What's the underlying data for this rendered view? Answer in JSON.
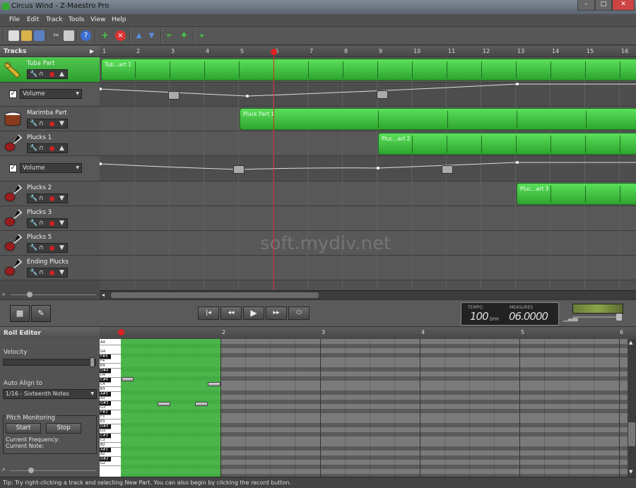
{
  "window": {
    "title": "Circus Wind - Z-Maestro Pro",
    "min": "–",
    "max": "□",
    "close": "✕"
  },
  "menu": [
    "File",
    "Edit",
    "Track",
    "Tools",
    "View",
    "Help"
  ],
  "tracks_panel": {
    "label": "Tracks",
    "expand": "▶"
  },
  "ruler": [
    "1",
    "2",
    "3",
    "4",
    "5",
    "6",
    "7",
    "8",
    "9",
    "10",
    "11",
    "12",
    "13",
    "14",
    "15",
    "16"
  ],
  "tracks": [
    {
      "name": "Tuba Part",
      "icon": "tuba-icon"
    },
    {
      "automation": "Volume"
    },
    {
      "name": "Marimba Part",
      "icon": "drum-icon"
    },
    {
      "name": "Plucks 1",
      "icon": "guitar-icon"
    },
    {
      "automation": "Volume"
    },
    {
      "name": "Plucks 2",
      "icon": "guitar-icon"
    },
    {
      "name": "Plucks 3",
      "icon": "guitar-icon"
    },
    {
      "name": "Plucks 5",
      "icon": "guitar-icon"
    },
    {
      "name": "Ending Plucks",
      "icon": "guitar-icon"
    }
  ],
  "parts": [
    {
      "label": "Tub...art 1"
    },
    {
      "label": "Pluck Part 1"
    },
    {
      "label": "Pluc...art 2"
    },
    {
      "label": "Pluc...art 3"
    }
  ],
  "checkmark": "✓",
  "dropdown_arrow": "▼",
  "transport": {
    "rewind_start": "|◂",
    "rewind": "◂◂",
    "play": "▶",
    "forward": "▸▸",
    "loop": "⬭",
    "tempo_label": "TEMPO",
    "tempo_value": "100",
    "tempo_unit": "BPM",
    "measures_label": "MEASURES",
    "measures_value": "06.0000"
  },
  "roll": {
    "label": "Roll Editor",
    "ruler": [
      "2",
      "3",
      "4",
      "5",
      "6"
    ],
    "velocity_label": "Velocity",
    "align_label": "Auto Align to",
    "align_value": "1/16 - Sixteenth Notes",
    "pitch_label": "Pitch Monitoring",
    "start": "Start",
    "stop": "Stop",
    "freq_label": "Current Frequency:",
    "note_label": "Current Note:",
    "keys": [
      "A4",
      "G4",
      "F#4",
      "F4",
      "E4",
      "D#4",
      "D4",
      "C#4",
      "C4",
      "B3",
      "A#3",
      "A3",
      "G#3",
      "G3",
      "F#3",
      "F3",
      "E3",
      "D#3",
      "D3",
      "C#3",
      "C3",
      "B2",
      "A#2",
      "A2",
      "G#2",
      "G2"
    ]
  },
  "status": "Tip: Try right-clicking a track and selecting New Part. You can also begin by clicking the record button.",
  "watermark": "soft.mydiv.net"
}
